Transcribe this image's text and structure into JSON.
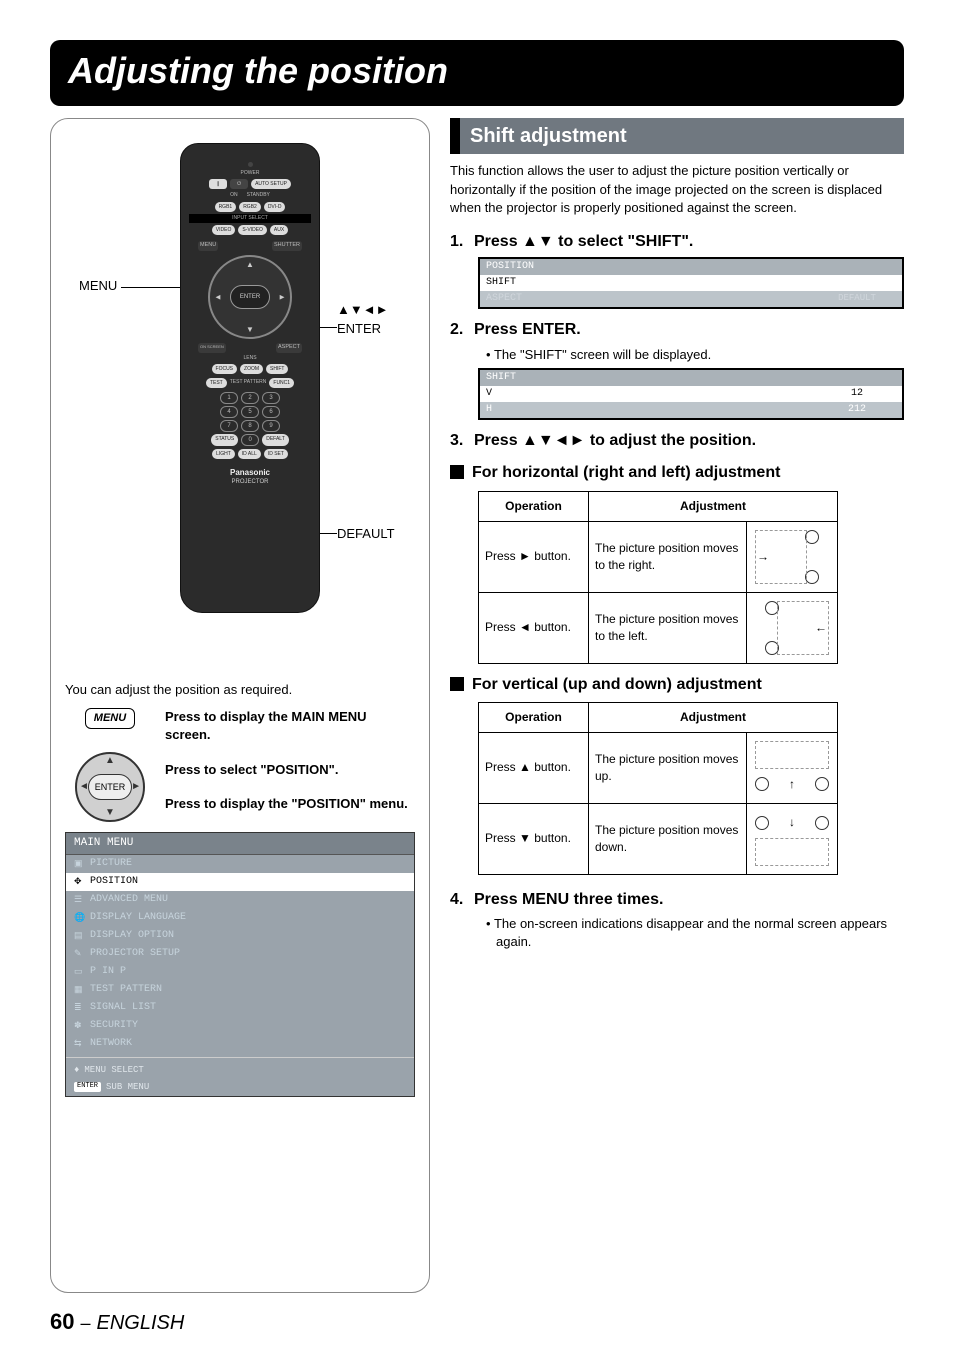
{
  "title": "Adjusting the position",
  "remote_callouts": {
    "menu": "MENU",
    "arrows_enter": "▲▼◄►\nENTER",
    "default": "DEFAULT"
  },
  "remote": {
    "power": "POWER",
    "on": "ON",
    "standby": "STANDBY",
    "auto_setup": "AUTO SETUP",
    "rgb1": "RGB1",
    "rgb2": "RGB2",
    "dvid": "DVI-D",
    "input_select": "INPUT SELECT",
    "video": "VIDEO",
    "svideo": "S-VIDEO",
    "aux": "AUX",
    "menu": "MENU",
    "shutter": "SHUTTER",
    "enter": "ENTER",
    "on_screen": "ON SCREEN",
    "aspect": "ASPECT",
    "lens": "LENS",
    "focus": "FOCUS",
    "zoom": "ZOOM",
    "shift": "SHIFT",
    "test_pattern": "TEST PATTERN",
    "test": "TEST",
    "func1": "FUNC1",
    "status": "STATUS",
    "default": "DEFALT",
    "light": "LIGHT",
    "idall": "ID ALL",
    "idset": "ID SET",
    "brand": "Panasonic",
    "prod": "PROJECTOR"
  },
  "left": {
    "intro": "You can adjust the position as required.",
    "menu_chip": "MENU",
    "enter_chip": "ENTER",
    "step_a": "Press to display the MAIN MENU screen.",
    "step_b": "Press to select \"POSITION\".",
    "step_c": "Press to display the \"POSITION\" menu.",
    "osd_title": "MAIN MENU",
    "osd_items": [
      {
        "label": "PICTURE",
        "icon": "▣",
        "sel": false
      },
      {
        "label": "POSITION",
        "icon": "✥",
        "sel": true
      },
      {
        "label": "ADVANCED MENU",
        "icon": "☰",
        "sel": false
      },
      {
        "label": "DISPLAY LANGUAGE",
        "icon": "🌐",
        "sel": false
      },
      {
        "label": "DISPLAY OPTION",
        "icon": "▤",
        "sel": false
      },
      {
        "label": "PROJECTOR SETUP",
        "icon": "✎",
        "sel": false
      },
      {
        "label": "P IN P",
        "icon": "▭",
        "sel": false
      },
      {
        "label": "TEST PATTERN",
        "icon": "▦",
        "sel": false
      },
      {
        "label": "SIGNAL LIST",
        "icon": "≣",
        "sel": false
      },
      {
        "label": "SECURITY",
        "icon": "✽",
        "sel": false
      },
      {
        "label": "NETWORK",
        "icon": "⇆",
        "sel": false
      }
    ],
    "osd_foot1_icon": "♦",
    "osd_foot1": "MENU SELECT",
    "osd_foot2_box": "ENTER",
    "osd_foot2": "SUB MENU"
  },
  "right": {
    "section_title": "Shift adjustment",
    "intro": "This function allows the user to adjust the picture position vertically or horizontally if the position of the image projected on the screen is displaced when the projector is properly positioned against the screen.",
    "step1": "Press ▲▼ to select  \"SHIFT\".",
    "table1": [
      {
        "k": "POSITION",
        "v": "",
        "style": "title"
      },
      {
        "k": "SHIFT",
        "v": "",
        "style": "sel"
      },
      {
        "k": "ASPECT",
        "v": "DEFAULT",
        "style": "faint"
      }
    ],
    "step2": "Press ENTER.",
    "step2_sub": "The \"SHIFT\" screen will be displayed.",
    "table2_title": "SHIFT",
    "table2": [
      {
        "k": "V",
        "v": "12",
        "style": "sel"
      },
      {
        "k": "H",
        "v": "212",
        "style": ""
      }
    ],
    "step3": "Press ▲▼◄► to adjust the position.",
    "subhead_h": "For horizontal (right and left) adjustment",
    "th_op": "Operation",
    "th_adj": "Adjustment",
    "h_rows": [
      {
        "op": "Press ► button.",
        "adj": "The picture position moves to the right."
      },
      {
        "op": "Press ◄ button.",
        "adj": "The picture position moves to the left."
      }
    ],
    "subhead_v": "For vertical (up and down) adjustment",
    "v_rows": [
      {
        "op": "Press ▲ button.",
        "adj": "The picture position moves up."
      },
      {
        "op": "Press ▼ button.",
        "adj": "The picture position moves down."
      }
    ],
    "step4": "Press MENU three times.",
    "step4_sub": "The on-screen indications disappear and the normal screen appears again."
  },
  "footer": {
    "page": "60",
    "dash": "–",
    "lang": "ENGLISH"
  }
}
